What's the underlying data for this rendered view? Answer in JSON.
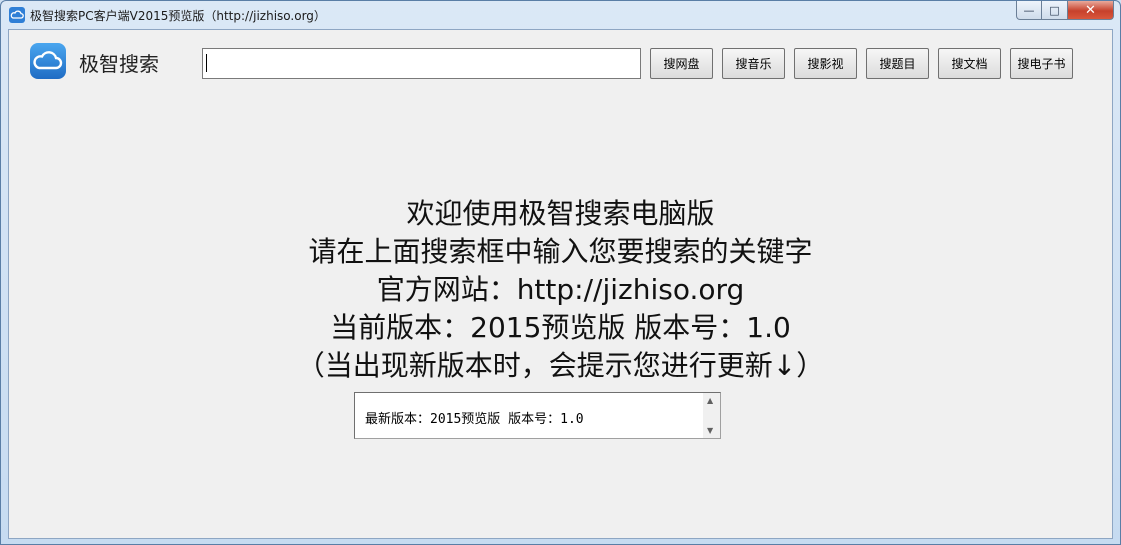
{
  "window": {
    "title": "极智搜索PC客户端V2015预览版（http://jizhiso.org）",
    "controls": {
      "minimize": "—",
      "maximize": "□",
      "close": "✕"
    }
  },
  "header": {
    "brand": "极智搜索",
    "search": {
      "value": "",
      "placeholder": ""
    },
    "buttons": [
      "搜网盘",
      "搜音乐",
      "搜影视",
      "搜题目",
      "搜文档",
      "搜电子书"
    ]
  },
  "welcome": {
    "lines": [
      "欢迎使用极智搜索电脑版",
      "请在上面搜索框中输入您要搜索的关键字",
      "官方网站：http://jizhiso.org",
      "当前版本：2015预览版  版本号：1.0",
      "（当出现新版本时，会提示您进行更新↓）"
    ]
  },
  "version_box": {
    "text": "最新版本：2015预览版 版本号：1.0"
  },
  "icons": {
    "app": "cloud-icon",
    "logo": "cloud-icon"
  },
  "colors": {
    "frame": "#cfe0f2",
    "client": "#f0f0f0",
    "logo": "#1f6cc4",
    "close": "#c7412c"
  }
}
